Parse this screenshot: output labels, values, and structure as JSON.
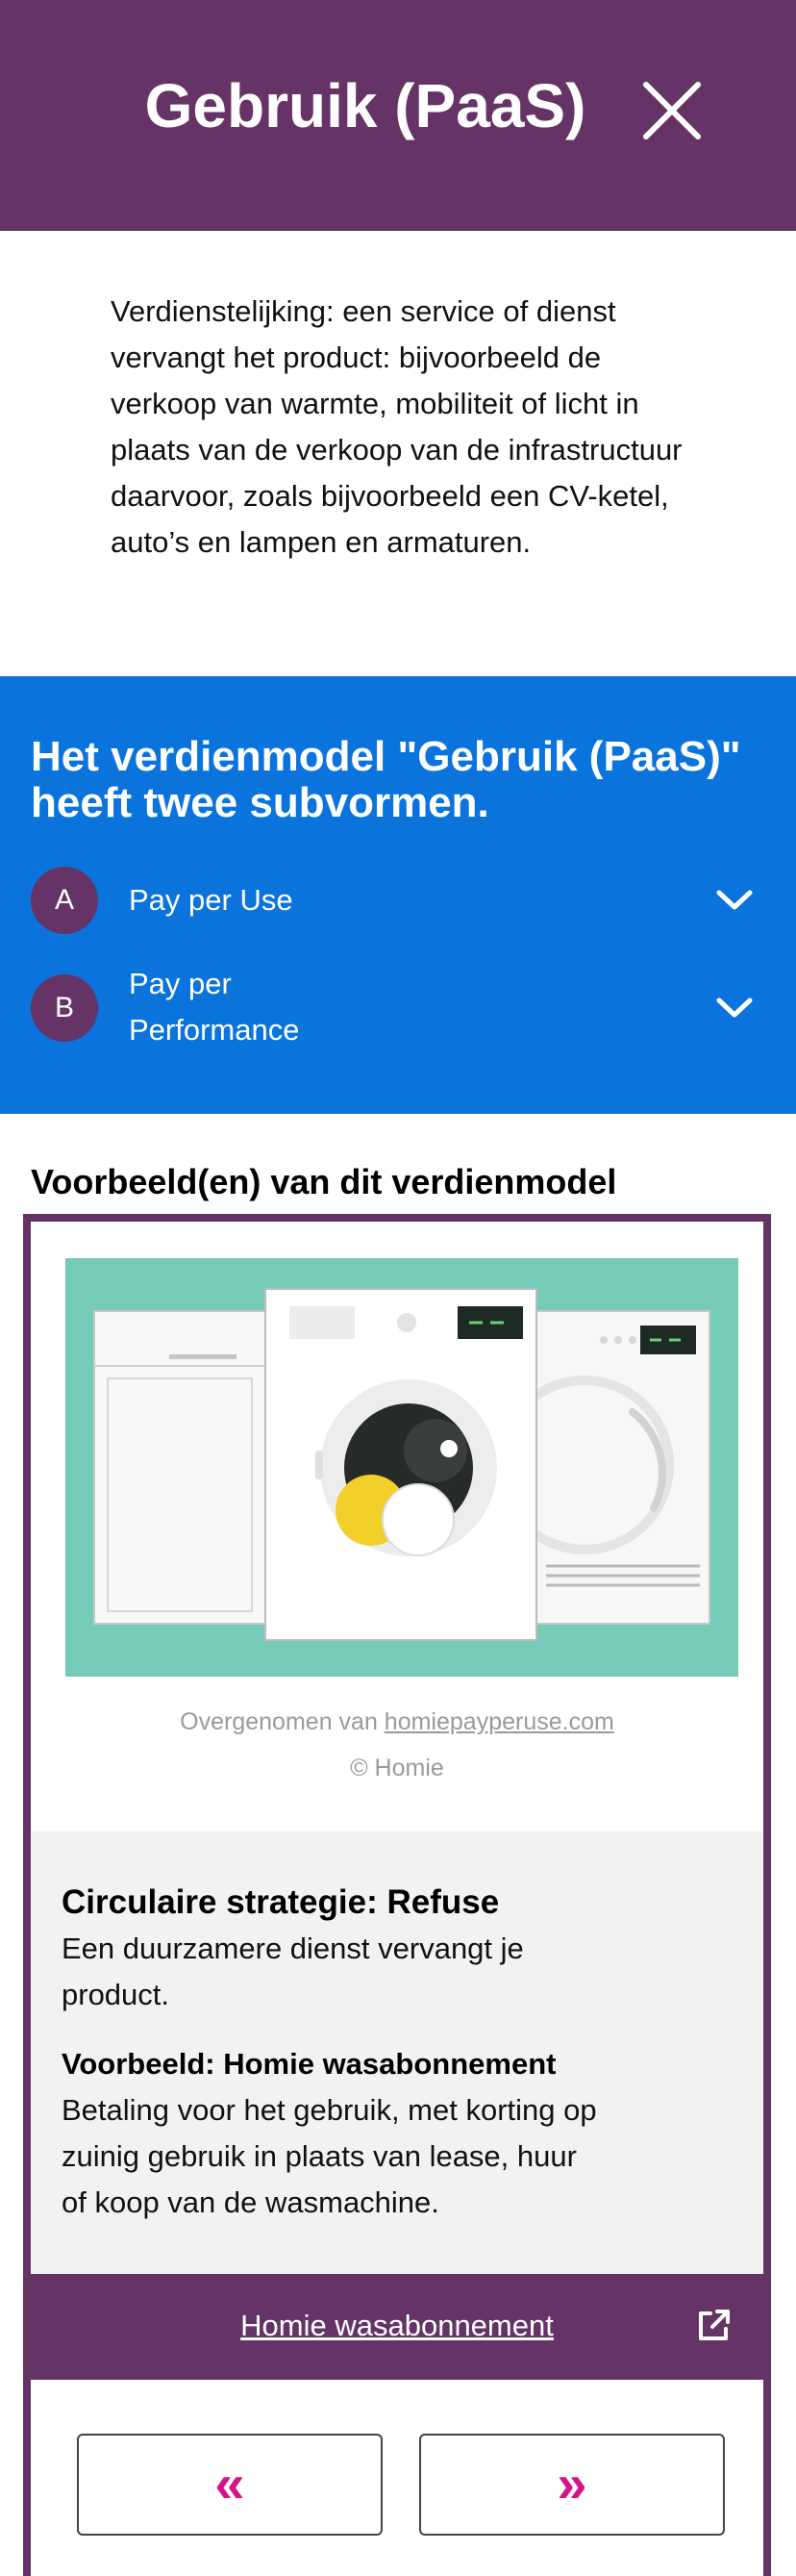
{
  "header": {
    "title": "Gebruik (PaaS)",
    "close_icon": "close-icon"
  },
  "intro": "Verdienstelijking: een service of dienst vervangt het product: bijvoorbeeld de verkoop van warmte, mobiliteit of licht in plaats van de verkoop van de infrastructuur daarvoor, zoals bijvoorbeeld een CV-ketel, auto’s en lampen en armaturen.",
  "subforms": {
    "title": "Het verdienmodel \"Gebruik (PaaS)\" heeft twee subvormen.",
    "items": [
      {
        "badge": "A",
        "label": "Pay per Use"
      },
      {
        "badge": "B",
        "label_line1": "Pay per",
        "label_line2": "Performance"
      }
    ]
  },
  "examples": {
    "title": "Voorbeeld(en) van dit verdienmodel",
    "credit_prefix": "Overgenomen van ",
    "credit_link": "homiepayperuse.com",
    "copyright": "© Homie",
    "strategy_title": "Circulaire strategie: Refuse",
    "strategy_text": "Een duurzamere dienst vervangt je product.",
    "example_title": "Voorbeeld: Homie wasabonnement",
    "example_text": "Betaling voor het gebruik, met korting op zuinig gebruik in plaats van lease, huur of koop van de wasmachine.",
    "link_label": "Homie wasabonnement",
    "prev_label": "«",
    "next_label": "»"
  },
  "colors": {
    "header": "#663366",
    "blue_panel": "#0a74dc",
    "illustration_bg": "#76cbb8",
    "arrow": "#d4148a",
    "grey_panel": "#f2f2f2"
  }
}
